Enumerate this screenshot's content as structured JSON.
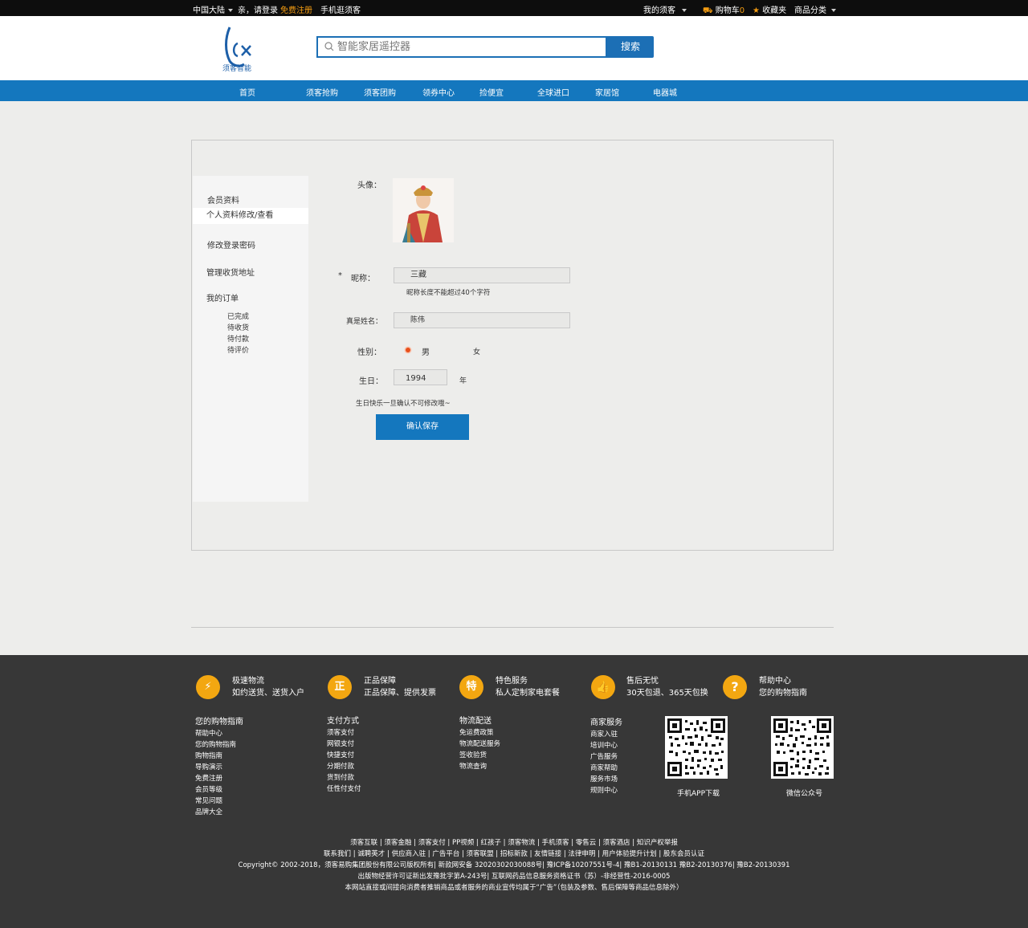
{
  "topbar": {
    "region": "中国大陆",
    "greeting": "亲，请登录",
    "register": "免费注册",
    "mobile": "手机逛须客",
    "my_account": "我的须客",
    "cart_label": "购物车",
    "cart_count": "0",
    "favorites": "收藏夹",
    "categories": "商品分类"
  },
  "header": {
    "logo_text": "须客智能",
    "search_placeholder": "智能家居遥控器",
    "search_button": "搜索"
  },
  "nav": [
    "首页",
    "须客抢购",
    "须客团购",
    "领券中心",
    "捡便宜",
    "全球进口",
    "家居馆",
    "电器城"
  ],
  "sidebar": {
    "section_title": "会员资料",
    "items": [
      "个人资料修改/查看",
      "修改登录密码",
      "管理收货地址",
      "我的订单"
    ],
    "order_sub": [
      "已完成",
      "待收货",
      "待付款",
      "待评价"
    ]
  },
  "form": {
    "avatar_label": "头像：",
    "required_mark": "*",
    "nickname_label": "昵称：",
    "nickname_value": "三藏",
    "nickname_hint": "昵称长度不能超过40个字符",
    "realname_label": "真是姓名：",
    "realname_value": "陈伟",
    "gender_label": "性别：",
    "gender_male": "男",
    "gender_female": "女",
    "birthday_label": "生日：",
    "birthday_year": "1994",
    "year_unit": "年",
    "birthday_hint": "生日快乐一旦确认不可修改哦~",
    "save_button": "确认保存"
  },
  "footer": {
    "services": [
      {
        "icon": "lightning-icon",
        "glyph": "⚡",
        "title": "极速物流",
        "desc": "如约送货、送货入户"
      },
      {
        "icon": "genuine-icon",
        "glyph": "正",
        "title": "正品保障",
        "desc": "正品保障、提供发票"
      },
      {
        "icon": "special-icon",
        "glyph": "特",
        "title": "特色服务",
        "desc": "私人定制家电套餐"
      },
      {
        "icon": "thumbs-up-icon",
        "glyph": "👍",
        "title": "售后无忧",
        "desc": "30天包退、365天包换"
      },
      {
        "icon": "help-icon",
        "glyph": "?",
        "title": "帮助中心",
        "desc": "您的购物指南"
      }
    ],
    "columns": [
      {
        "title": "您的购物指南",
        "links": [
          "帮助中心",
          "您的购物指南",
          "购物指南",
          "导购演示",
          "免费注册",
          "会员等级",
          "常见问题",
          "品牌大全"
        ]
      },
      {
        "title": "支付方式",
        "links": [
          "须客支付",
          "网银支付",
          "快捷支付",
          "分期付款",
          "货到付款",
          "任性付支付"
        ]
      },
      {
        "title": "物流配送",
        "links": [
          "免运费政策",
          "物流配送服务",
          "签收验货",
          "物流查询"
        ]
      },
      {
        "title": "商家服务",
        "links": [
          "商家入驻",
          "培训中心",
          "广告服务",
          "商家帮助",
          "服务市场",
          "规则中心"
        ]
      }
    ],
    "qr_codes": [
      {
        "label": "手机APP下载"
      },
      {
        "label": "微信公众号"
      }
    ],
    "bottom_lines": [
      "须客互联 | 须客金融 | 须客支付 | PP视频 | 红孩子 | 须客物流 | 手机须客 | 零售云 | 须客酒店 | 知识产权举报",
      "联系我们 | 诚聘英才 | 供应商入驻 | 广告平台 | 须客联盟 | 招标新款 | 友情链接 | 法律申明 | 用户体验提升计划 | 股东会员认证",
      "Copyright© 2002-2018，须客易购集团股份有限公司版权所有| 新款网安备 32020302030088号| 豫ICP备10207551号-4| 豫B1-20130131 豫B2-20130376| 豫B2-20130391",
      "出版物经营许可证新出发豫批字第A-243号| 互联网药品信息服务资格证书（苏）-非经营性-2016-0005",
      "本网站直接或间接向消费者推销商品或者服务的商业宣传均属于“广告”（包装及参数、售后保障等商品信息除外）"
    ]
  }
}
